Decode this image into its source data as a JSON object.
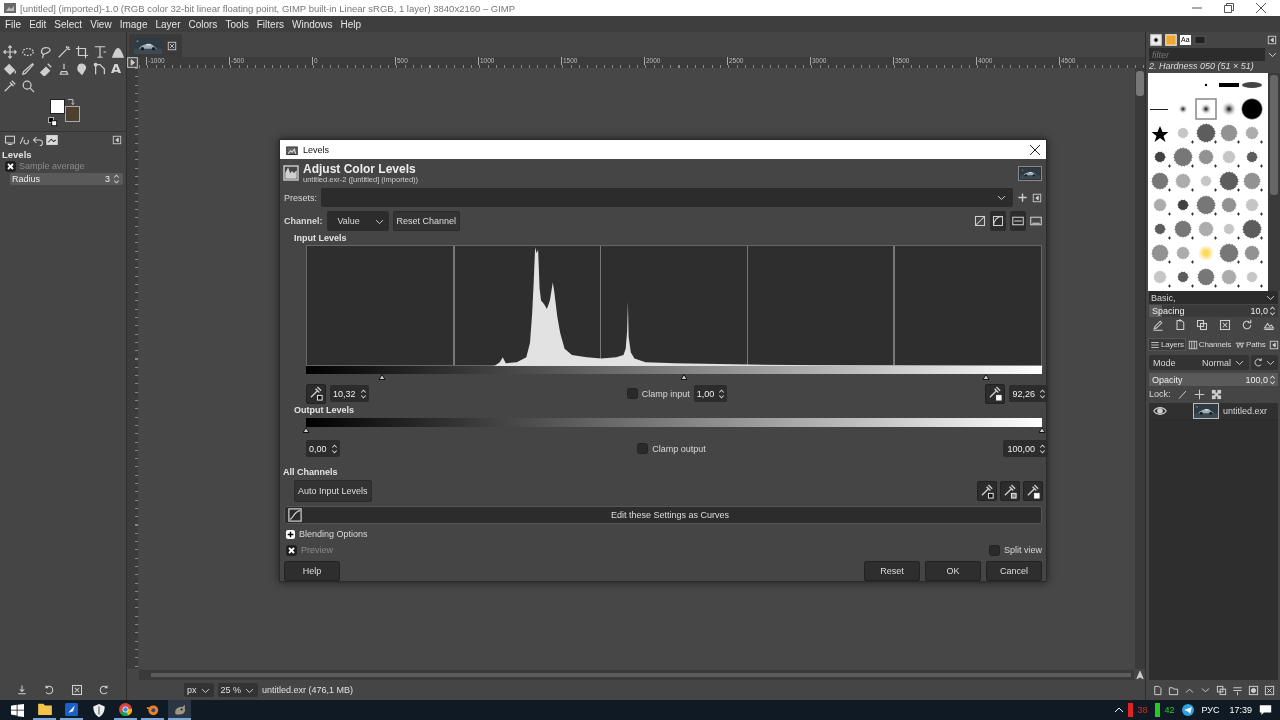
{
  "window": {
    "title": "[untitled] (imported)-1.0 (RGB color 32-bit linear floating point, GIMP built-in Linear sRGB, 1 layer) 3840x2160 – GIMP"
  },
  "menu": [
    "File",
    "Edit",
    "Select",
    "View",
    "Image",
    "Layer",
    "Colors",
    "Tools",
    "Filters",
    "Windows",
    "Help"
  ],
  "toolbox": {
    "text_tool_glyph": "A"
  },
  "tool_options": {
    "title": "Levels",
    "sample_average": {
      "label": "Sample average",
      "checked": true,
      "disabled": true
    },
    "radius": {
      "label": "Radius",
      "value": "3"
    }
  },
  "ruler": {
    "labels": [
      "-1000",
      "-500",
      "0",
      "500",
      "1000",
      "1500",
      "2000",
      "2500",
      "3000",
      "3500",
      "4000",
      "4500"
    ]
  },
  "dialog": {
    "title": "Levels",
    "heading": "Adjust Color Levels",
    "subheading": "untitled.exr-2 ([untitled] (imported))",
    "presets_label": "Presets:",
    "channel_label": "Channel:",
    "channel": "Value",
    "reset_channel": "Reset Channel",
    "input_label": "Input Levels",
    "input": {
      "low": "10,32",
      "gamma": "1,00",
      "high": "92,26",
      "clamp_label": "Clamp input",
      "clamp": false,
      "handles": [
        {
          "level": 0.103
        },
        {
          "level": 0.513
        },
        {
          "level": 0.924
        }
      ]
    },
    "output_label": "Output Levels",
    "output": {
      "low": "0,00",
      "high": "100,00",
      "clamp_label": "Clamp output",
      "clamp": false,
      "handles": [
        {
          "level": 0
        },
        {
          "level": 1
        }
      ]
    },
    "all_channels_label": "All Channels",
    "auto_button": "Auto Input Levels",
    "curves_button": "Edit these Settings as Curves",
    "blending_options": {
      "label": "Blending Options",
      "expanded": false
    },
    "preview": {
      "label": "Preview",
      "checked": true,
      "disabled": true
    },
    "split_view": {
      "label": "Split view",
      "checked": false
    },
    "buttons": [
      "Help",
      "Reset",
      "OK",
      "Cancel"
    ]
  },
  "brushes": {
    "font_tab_glyph": "Aa",
    "filter_placeholder": "filter",
    "selected_brush": "2. Hardness 050 (51 × 51)",
    "tag": "Basic,",
    "spacing": {
      "label": "Spacing",
      "value": "10,0",
      "level": 0.1
    }
  },
  "layers": {
    "tabs": [
      {
        "label": "Layers",
        "selected": true
      },
      {
        "label": "Channels",
        "selected": false
      },
      {
        "label": "Paths",
        "selected": false
      }
    ],
    "mode_label": "Mode",
    "mode": "Normal",
    "opacity": {
      "label": "Opacity",
      "value": "100,0",
      "level": 1
    },
    "lock_label": "Lock:",
    "items": [
      {
        "name": "untitled.exr",
        "visible": true
      }
    ]
  },
  "status_bar": {
    "unit": "px",
    "zoom": "25 %",
    "info": "untitled.exr (476,1 MB)"
  },
  "taskbar": {
    "indicators": [
      {
        "value": "38",
        "color": "#e02424"
      },
      {
        "value": "42",
        "color": "#28c828"
      }
    ],
    "language": "РУС",
    "time": "17:39"
  }
}
